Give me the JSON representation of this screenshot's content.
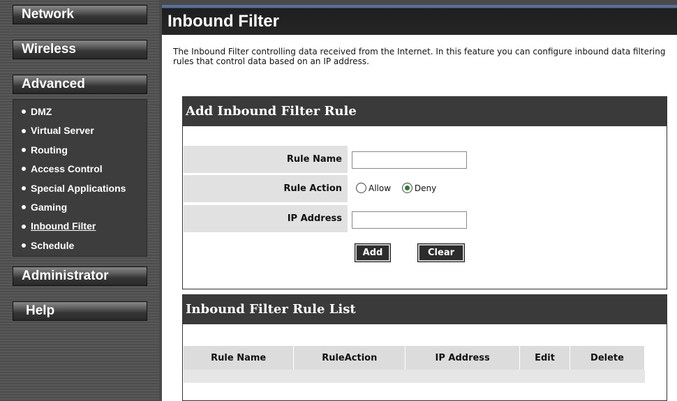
{
  "sidebar": {
    "network": "Network",
    "wireless": "Wireless",
    "advanced": "Advanced",
    "submenu": [
      {
        "label": "DMZ"
      },
      {
        "label": "Virtual Server"
      },
      {
        "label": "Routing"
      },
      {
        "label": "Access Control"
      },
      {
        "label": "Special Applications"
      },
      {
        "label": "Gaming"
      },
      {
        "label": "Inbound Filter",
        "active": true
      },
      {
        "label": "Schedule"
      }
    ],
    "administrator": "Administrator",
    "help": "Help"
  },
  "main": {
    "title": "Inbound Filter",
    "intro": "The Inbound Filter controlling data received from the Internet. In this feature you can configure inbound data filtering rules that control data based on an IP address."
  },
  "add_panel": {
    "heading": "Add Inbound Filter Rule",
    "rule_name_label": "Rule Name",
    "rule_name_value": "",
    "rule_action_label": "Rule Action",
    "allow_label": "Allow",
    "deny_label": "Deny",
    "selected_action": "Deny",
    "ip_address_label": "IP Address",
    "ip_address_value": "",
    "add_button": "Add",
    "clear_button": "Clear"
  },
  "list_panel": {
    "heading": "Inbound Filter Rule List",
    "columns": [
      "Rule Name",
      "RuleAction",
      "IP Address",
      "Edit",
      "Delete"
    ]
  },
  "colors": {
    "title_bar_top": "#5a6f9a",
    "panel_header": "#3a3a3a",
    "row_label_bg": "#e1e1e1",
    "radio_checked": "#2d7a2d"
  }
}
